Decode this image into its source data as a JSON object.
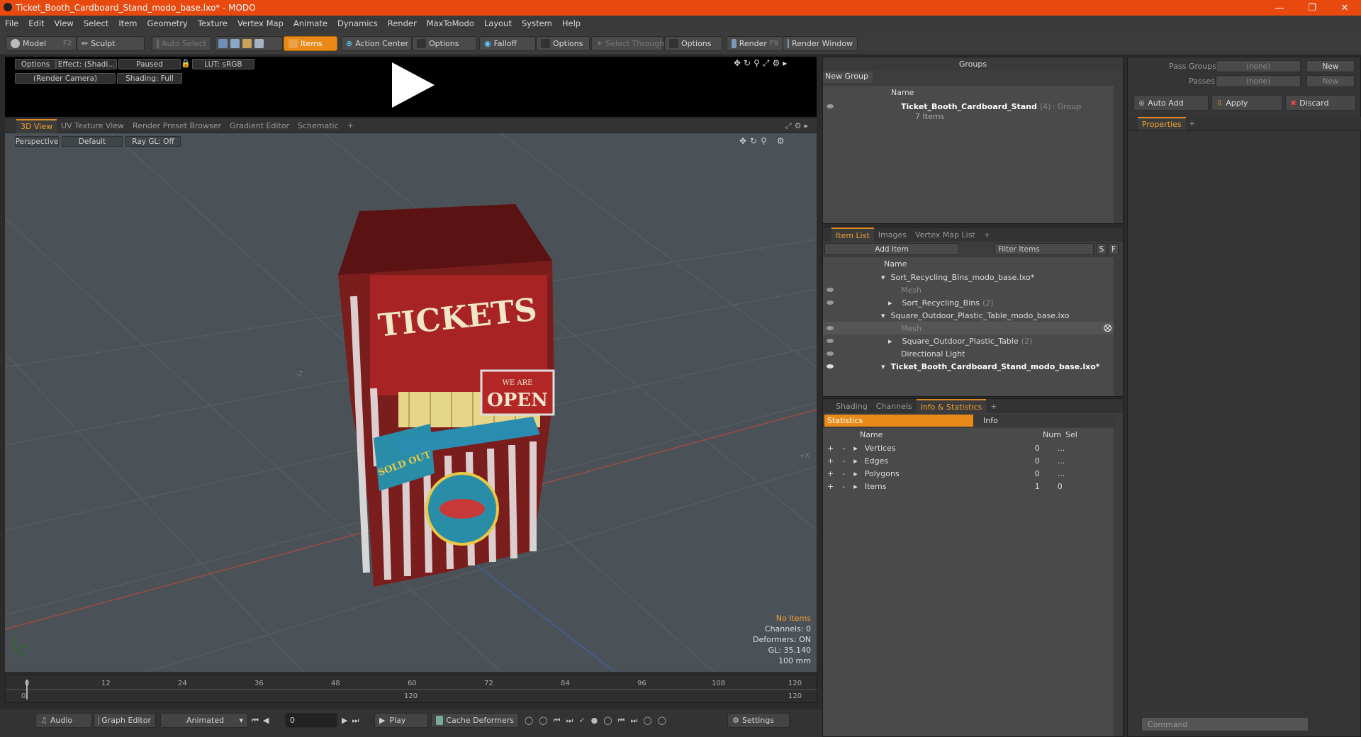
{
  "window": {
    "title": "Ticket_Booth_Cardboard_Stand_modo_base.lxo* - MODO"
  },
  "menu": [
    "File",
    "Edit",
    "View",
    "Select",
    "Item",
    "Geometry",
    "Texture",
    "Vertex Map",
    "Animate",
    "Dynamics",
    "Render",
    "MaxToModo",
    "Layout",
    "System",
    "Help"
  ],
  "toolbar": {
    "model": "Model",
    "model_key": "F2",
    "sculpt": "Sculpt",
    "auto_select": "Auto Select",
    "items": "Items",
    "action_center": "Action Center",
    "options1": "Options",
    "falloff": "Falloff",
    "options2": "Options",
    "select_through": "Select Through",
    "options3": "Options",
    "render": "Render",
    "render_key": "F9",
    "render_window": "Render Window"
  },
  "preview": {
    "options": "Options",
    "effect": "Effect: (Shadi...",
    "paused": "Paused",
    "lut": "LUT: sRGB",
    "camera": "(Render Camera)",
    "shading": "Shading: Full"
  },
  "view_tabs": [
    "3D View",
    "UV Texture View",
    "Render Preset Browser",
    "Gradient Editor",
    "Schematic",
    "+"
  ],
  "viewport": {
    "perspective": "Perspective",
    "default": "Default",
    "raygl": "Ray GL: Off",
    "axis_z": "-Z",
    "axis_x": "+X",
    "stats": {
      "no_items": "No Items",
      "channels": "Channels: 0",
      "deformers": "Deformers: ON",
      "gl": "GL: 35,140",
      "scale": "100 mm"
    }
  },
  "timeline": {
    "ticks": [
      "0",
      "12",
      "24",
      "36",
      "48",
      "60",
      "72",
      "84",
      "96",
      "108",
      "120"
    ],
    "start": "0",
    "mid": "120",
    "end": "120"
  },
  "bottom": {
    "audio": "Audio",
    "graph_editor": "Graph Editor",
    "animated": "Animated",
    "frame": "0",
    "play": "Play",
    "cache": "Cache Deformers",
    "settings": "Settings"
  },
  "groups": {
    "title": "Groups",
    "new_group": "New Group",
    "col_name": "Name",
    "item_name": "Ticket_Booth_Cardboard_Stand",
    "item_count": "(4)",
    "item_type": ": Group",
    "item_sub": "7 Items"
  },
  "pass": {
    "pass_groups": "Pass Groups",
    "passes": "Passes",
    "none1": "(none)",
    "none2": "(none)",
    "new1": "New",
    "new2": "New",
    "auto_add": "Auto Add",
    "apply": "Apply",
    "discard": "Discard",
    "properties": "Properties",
    "plus": "+"
  },
  "itemlist": {
    "tabs": [
      "Item List",
      "Images",
      "Vertex Map List",
      "+"
    ],
    "add_item": "Add Item",
    "filter": "Filter Items",
    "s": "S",
    "f": "F",
    "col_name": "Name",
    "rows": [
      {
        "label": "Sort_Recycling_Bins_modo_base.lxo*",
        "extra": ""
      },
      {
        "label": "Mesh",
        "extra": ""
      },
      {
        "label": "Sort_Recycling_Bins",
        "extra": "(2)"
      },
      {
        "label": "Square_Outdoor_Plastic_Table_modo_base.lxo",
        "extra": ""
      },
      {
        "label": "Mesh",
        "extra": ""
      },
      {
        "label": "Square_Outdoor_Plastic_Table",
        "extra": "(2)"
      },
      {
        "label": "Directional Light",
        "extra": ""
      },
      {
        "label": "Ticket_Booth_Cardboard_Stand_modo_base.lxo*",
        "extra": ""
      }
    ]
  },
  "stats": {
    "tabs": [
      "Shading",
      "Channels",
      "Info & Statistics",
      "+"
    ],
    "sub_statistics": "Statistics",
    "sub_info": "Info",
    "cols": {
      "name": "Name",
      "num": "Num",
      "sel": "Sel"
    },
    "rows": [
      {
        "name": "Vertices",
        "num": "0",
        "sel": "..."
      },
      {
        "name": "Edges",
        "num": "0",
        "sel": "..."
      },
      {
        "name": "Polygons",
        "num": "0",
        "sel": "..."
      },
      {
        "name": "Items",
        "num": "1",
        "sel": "0"
      }
    ]
  },
  "command": {
    "placeholder": "Command"
  },
  "booth": {
    "sign": "TICKETS",
    "open_top": "WE ARE",
    "open": "OPEN",
    "sold": "SOLD OUT"
  },
  "colors": {
    "accent": "#e98a18",
    "title": "#e8490f"
  }
}
